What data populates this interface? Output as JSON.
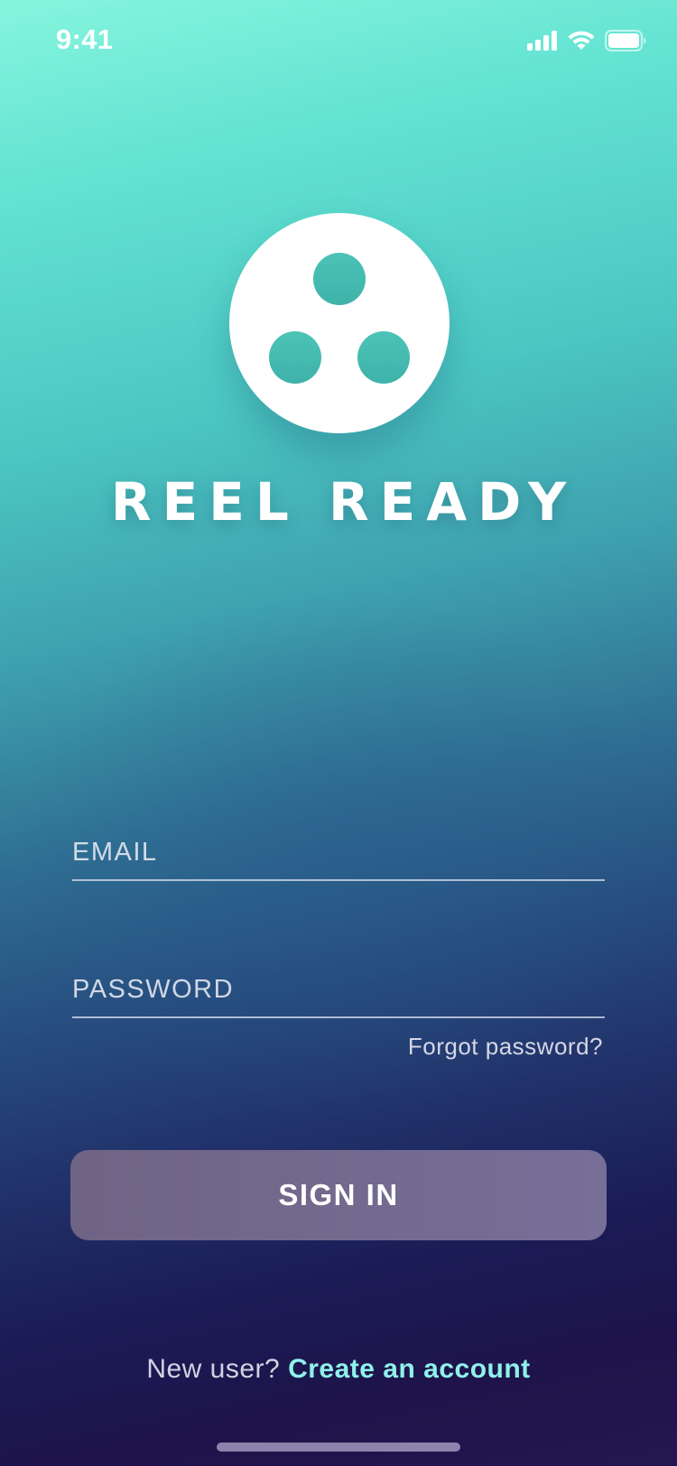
{
  "status_bar": {
    "time": "9:41",
    "icons": [
      "signal-icon",
      "wifi-icon",
      "battery-icon"
    ]
  },
  "brand": {
    "logo_icon": "reel-logo-icon",
    "title": "REEL READY"
  },
  "form": {
    "email_placeholder": "EMAIL",
    "email_value": "",
    "password_placeholder": "PASSWORD",
    "password_value": "",
    "forgot_password": "Forgot password?",
    "sign_in_label": "SIGN IN"
  },
  "footer": {
    "new_user_prompt": "New user?",
    "create_account_link": "Create an account"
  },
  "colors": {
    "gradient_top": "#86f5de",
    "gradient_bottom": "#25164f",
    "button": "#736a8e",
    "link_accent": "#8ff1ea"
  }
}
